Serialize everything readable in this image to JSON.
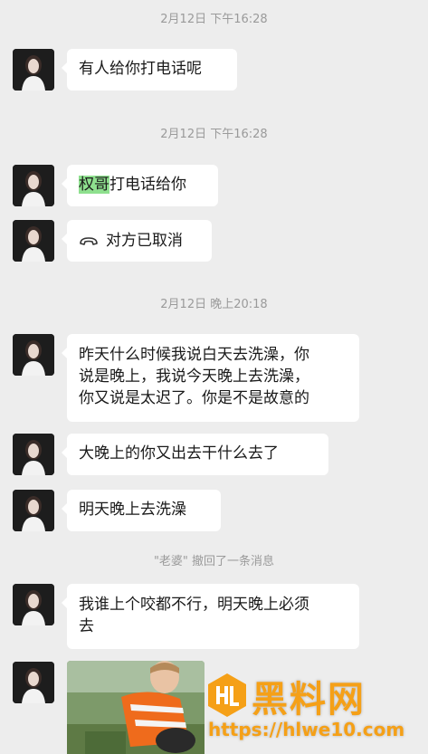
{
  "messages": {
    "t1": "2月12日 下午16:28",
    "m1": "有人给你打电话呢",
    "t2": "2月12日 下午16:28",
    "m2_highlight": "权哥",
    "m2_rest": "打电话给你",
    "m3": "对方已取消",
    "t3": "2月12日 晚上20:18",
    "m4_line1": "昨天什么时候我说白天去洗澡，你",
    "m4_line2": "说是晚上，我说今天晚上去洗澡，",
    "m4_line3": "你又说是太迟了。你是不是故意的",
    "m5": "大晚上的你又出去干什么去了",
    "m6": "明天晚上去洗澡",
    "recall_name": "\"老婆\"",
    "recall_text": " 撤回了一条消息",
    "m7_line1": "我谁上个咬都不行，明天晚上必须",
    "m7_line2": "去"
  },
  "watermark": {
    "title": "黑料网",
    "url": "https://hlwe10.com"
  },
  "icons": {
    "call": "hangup-phone-icon"
  },
  "colors": {
    "background": "#ededed",
    "bubble": "#ffffff",
    "highlight": "#8ee08e",
    "timestamp": "#9a9a9a",
    "watermark": "#f5a017"
  }
}
